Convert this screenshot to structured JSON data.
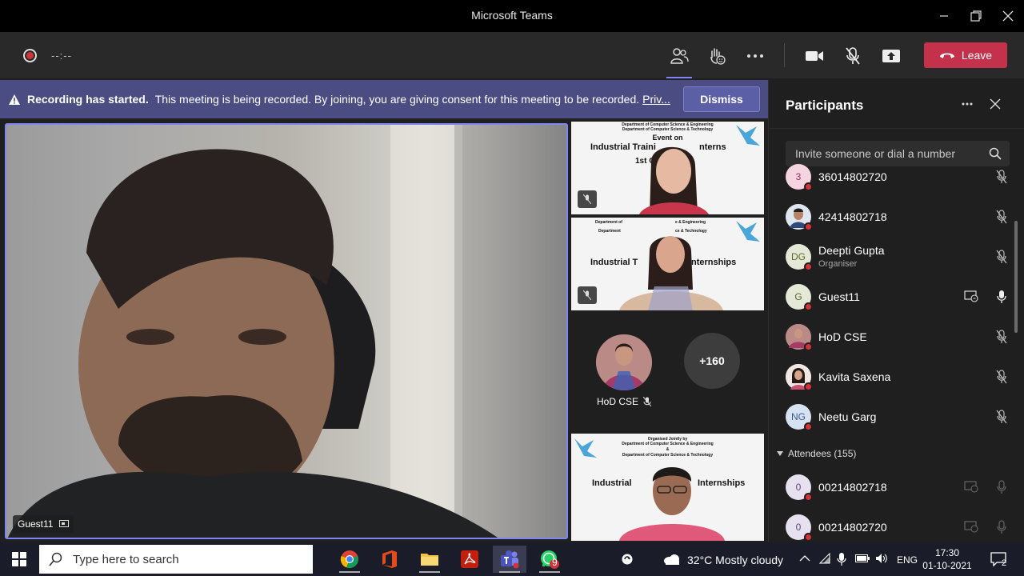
{
  "window": {
    "title": "Microsoft Teams"
  },
  "toolbar": {
    "timer": "--:--",
    "leave_label": "Leave"
  },
  "banner": {
    "heading": "Recording has started.",
    "message": "This meeting is being recorded. By joining, you are giving consent for this meeting to be recorded.",
    "link": "Priv...",
    "dismiss_label": "Dismiss"
  },
  "stage": {
    "main_speaker": "Guest11",
    "tile1": {
      "line1": "Department of Computer Science & Engineering",
      "line2": "Department of Computer Science & Technology",
      "line3": "Event on",
      "line4": "Industrial Traini",
      "line4b": "nterns",
      "line5": "1st Oc"
    },
    "tile2": {
      "line1": "Department of",
      "line1b": "e & Engineering",
      "line2": "Department",
      "line2b": "ce & Technology",
      "line3": "Industrial T",
      "line3b": "nternships"
    },
    "hod_label": "HoD CSE",
    "more_count": "+160",
    "tile3": {
      "line1": "Organised Jointly by",
      "line2": "Department of Computer Science & Engineering",
      "line3": "&",
      "line4": "Department of Computer Science & Technology",
      "line5": "Industrial",
      "line5b": "Internships"
    }
  },
  "panel": {
    "title": "Participants",
    "invite_placeholder": "Invite someone or dial a number",
    "presenters": [
      {
        "name": "36014802720",
        "initials": "3",
        "role": ""
      },
      {
        "name": "42414802718",
        "initials": "",
        "role": ""
      },
      {
        "name": "Deepti Gupta",
        "initials": "DG",
        "role": "Organiser"
      },
      {
        "name": "Guest11",
        "initials": "G",
        "role": ""
      },
      {
        "name": "HoD CSE",
        "initials": "",
        "role": ""
      },
      {
        "name": "Kavita Saxena",
        "initials": "",
        "role": ""
      },
      {
        "name": "Neetu Garg",
        "initials": "NG",
        "role": ""
      }
    ],
    "attendees_label": "Attendees (155)",
    "attendees": [
      {
        "name": "00214802718",
        "initials": "0"
      },
      {
        "name": "00214802720",
        "initials": "0"
      }
    ]
  },
  "taskbar": {
    "search_placeholder": "Type here to search",
    "whatsapp_badge": "9",
    "weather": "32°C  Mostly cloudy",
    "lang": "ENG",
    "time": "17:30",
    "date": "01-10-2021",
    "notifications": "2"
  },
  "colors": {
    "accent": "#7f85f5",
    "leave": "#c4314b",
    "banner": "#4a4c82",
    "status_red": "#d13438"
  }
}
